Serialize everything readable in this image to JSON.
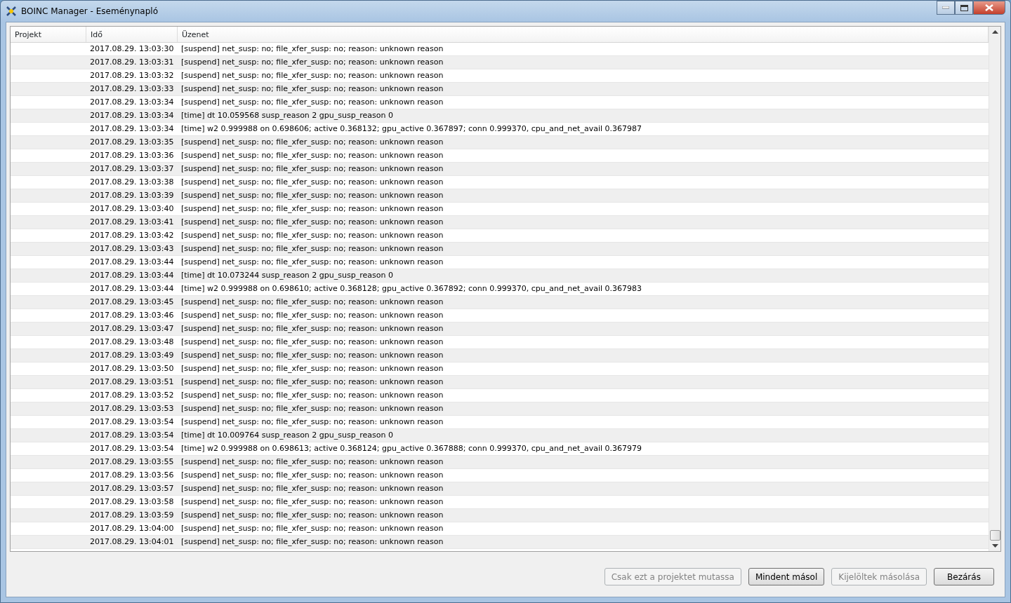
{
  "window": {
    "title": "BOINC Manager - Eseménynapló"
  },
  "table": {
    "columns": [
      "Projekt",
      "Idő",
      "Üzenet"
    ],
    "rows": [
      {
        "time": "2017.08.29. 13:03:30",
        "message": "[suspend] net_susp: no; file_xfer_susp: no; reason: unknown reason"
      },
      {
        "time": "2017.08.29. 13:03:31",
        "message": "[suspend] net_susp: no; file_xfer_susp: no; reason: unknown reason"
      },
      {
        "time": "2017.08.29. 13:03:32",
        "message": "[suspend] net_susp: no; file_xfer_susp: no; reason: unknown reason"
      },
      {
        "time": "2017.08.29. 13:03:33",
        "message": "[suspend] net_susp: no; file_xfer_susp: no; reason: unknown reason"
      },
      {
        "time": "2017.08.29. 13:03:34",
        "message": "[suspend] net_susp: no; file_xfer_susp: no; reason: unknown reason"
      },
      {
        "time": "2017.08.29. 13:03:34",
        "message": "[time] dt 10.059568 susp_reason 2 gpu_susp_reason 0"
      },
      {
        "time": "2017.08.29. 13:03:34",
        "message": "[time] w2 0.999988 on 0.698606; active 0.368132; gpu_active 0.367897; conn 0.999370, cpu_and_net_avail 0.367987"
      },
      {
        "time": "2017.08.29. 13:03:35",
        "message": "[suspend] net_susp: no; file_xfer_susp: no; reason: unknown reason"
      },
      {
        "time": "2017.08.29. 13:03:36",
        "message": "[suspend] net_susp: no; file_xfer_susp: no; reason: unknown reason"
      },
      {
        "time": "2017.08.29. 13:03:37",
        "message": "[suspend] net_susp: no; file_xfer_susp: no; reason: unknown reason"
      },
      {
        "time": "2017.08.29. 13:03:38",
        "message": "[suspend] net_susp: no; file_xfer_susp: no; reason: unknown reason"
      },
      {
        "time": "2017.08.29. 13:03:39",
        "message": "[suspend] net_susp: no; file_xfer_susp: no; reason: unknown reason"
      },
      {
        "time": "2017.08.29. 13:03:40",
        "message": "[suspend] net_susp: no; file_xfer_susp: no; reason: unknown reason"
      },
      {
        "time": "2017.08.29. 13:03:41",
        "message": "[suspend] net_susp: no; file_xfer_susp: no; reason: unknown reason"
      },
      {
        "time": "2017.08.29. 13:03:42",
        "message": "[suspend] net_susp: no; file_xfer_susp: no; reason: unknown reason"
      },
      {
        "time": "2017.08.29. 13:03:43",
        "message": "[suspend] net_susp: no; file_xfer_susp: no; reason: unknown reason"
      },
      {
        "time": "2017.08.29. 13:03:44",
        "message": "[suspend] net_susp: no; file_xfer_susp: no; reason: unknown reason"
      },
      {
        "time": "2017.08.29. 13:03:44",
        "message": "[time] dt 10.073244 susp_reason 2 gpu_susp_reason 0"
      },
      {
        "time": "2017.08.29. 13:03:44",
        "message": "[time] w2 0.999988 on 0.698610; active 0.368128; gpu_active 0.367892; conn 0.999370, cpu_and_net_avail 0.367983"
      },
      {
        "time": "2017.08.29. 13:03:45",
        "message": "[suspend] net_susp: no; file_xfer_susp: no; reason: unknown reason"
      },
      {
        "time": "2017.08.29. 13:03:46",
        "message": "[suspend] net_susp: no; file_xfer_susp: no; reason: unknown reason"
      },
      {
        "time": "2017.08.29. 13:03:47",
        "message": "[suspend] net_susp: no; file_xfer_susp: no; reason: unknown reason"
      },
      {
        "time": "2017.08.29. 13:03:48",
        "message": "[suspend] net_susp: no; file_xfer_susp: no; reason: unknown reason"
      },
      {
        "time": "2017.08.29. 13:03:49",
        "message": "[suspend] net_susp: no; file_xfer_susp: no; reason: unknown reason"
      },
      {
        "time": "2017.08.29. 13:03:50",
        "message": "[suspend] net_susp: no; file_xfer_susp: no; reason: unknown reason"
      },
      {
        "time": "2017.08.29. 13:03:51",
        "message": "[suspend] net_susp: no; file_xfer_susp: no; reason: unknown reason"
      },
      {
        "time": "2017.08.29. 13:03:52",
        "message": "[suspend] net_susp: no; file_xfer_susp: no; reason: unknown reason"
      },
      {
        "time": "2017.08.29. 13:03:53",
        "message": "[suspend] net_susp: no; file_xfer_susp: no; reason: unknown reason"
      },
      {
        "time": "2017.08.29. 13:03:54",
        "message": "[suspend] net_susp: no; file_xfer_susp: no; reason: unknown reason"
      },
      {
        "time": "2017.08.29. 13:03:54",
        "message": "[time] dt 10.009764 susp_reason 2 gpu_susp_reason 0"
      },
      {
        "time": "2017.08.29. 13:03:54",
        "message": "[time] w2 0.999988 on 0.698613; active 0.368124; gpu_active 0.367888; conn 0.999370, cpu_and_net_avail 0.367979"
      },
      {
        "time": "2017.08.29. 13:03:55",
        "message": "[suspend] net_susp: no; file_xfer_susp: no; reason: unknown reason"
      },
      {
        "time": "2017.08.29. 13:03:56",
        "message": "[suspend] net_susp: no; file_xfer_susp: no; reason: unknown reason"
      },
      {
        "time": "2017.08.29. 13:03:57",
        "message": "[suspend] net_susp: no; file_xfer_susp: no; reason: unknown reason"
      },
      {
        "time": "2017.08.29. 13:03:58",
        "message": "[suspend] net_susp: no; file_xfer_susp: no; reason: unknown reason"
      },
      {
        "time": "2017.08.29. 13:03:59",
        "message": "[suspend] net_susp: no; file_xfer_susp: no; reason: unknown reason"
      },
      {
        "time": "2017.08.29. 13:04:00",
        "message": "[suspend] net_susp: no; file_xfer_susp: no; reason: unknown reason"
      },
      {
        "time": "2017.08.29. 13:04:01",
        "message": "[suspend] net_susp: no; file_xfer_susp: no; reason: unknown reason"
      }
    ]
  },
  "buttons": [
    {
      "label": "Csak ezt a projektet mutassa",
      "disabled": true
    },
    {
      "label": "Mindent másol",
      "disabled": false
    },
    {
      "label": "Kijelöltek másolása",
      "disabled": true
    },
    {
      "label": "Bezárás",
      "disabled": false
    }
  ]
}
